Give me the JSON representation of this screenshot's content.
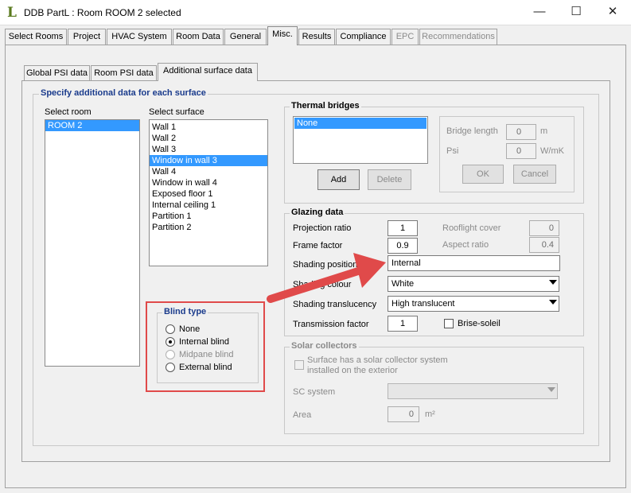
{
  "window": {
    "title": "DDB PartL : Room ROOM 2 selected",
    "logo_letter": "L",
    "minimize": "—",
    "maximize": "☐",
    "close": "✕"
  },
  "main_tabs": [
    "Select Rooms",
    "Project",
    "HVAC System",
    "Room Data",
    "General",
    "Misc.",
    "Results",
    "Compliance",
    "EPC",
    "Recommendations"
  ],
  "sub_tabs": [
    "Global PSI data",
    "Room PSI data",
    "Additional surface data"
  ],
  "section_title": "Specify additional data for each surface",
  "select_room": {
    "label": "Select room",
    "items": [
      "ROOM 2"
    ],
    "selected": 0
  },
  "select_surface": {
    "label": "Select surface",
    "items": [
      "Wall  1",
      "Wall  2",
      "Wall  3",
      "Window in wall  3",
      "Wall  4",
      "Window in wall  4",
      "Exposed floor  1",
      "Internal ceiling  1",
      "Partition  1",
      "Partition  2"
    ],
    "selected": 3
  },
  "blind_type": {
    "title": "Blind type",
    "options": [
      "None",
      "Internal blind",
      "Midpane blind",
      "External blind"
    ],
    "selected": 1,
    "disabled": [
      2
    ],
    "highlight_color": "#e04a4a"
  },
  "thermal_bridges": {
    "title": "Thermal bridges",
    "list": [
      "None"
    ],
    "add_label": "Add",
    "delete_label": "Delete",
    "bridge_length_label": "Bridge length",
    "bridge_length_value": "0",
    "bridge_length_unit": "m",
    "psi_label": "Psi",
    "psi_value": "0",
    "psi_unit": "W/mK",
    "ok_label": "OK",
    "cancel_label": "Cancel"
  },
  "glazing": {
    "title": "Glazing data",
    "projection_ratio_label": "Projection ratio",
    "projection_ratio": "1",
    "rooflight_cover_label": "Rooflight cover",
    "rooflight_cover": "0",
    "frame_factor_label": "Frame factor",
    "frame_factor": "0.9",
    "aspect_ratio_label": "Aspect ratio",
    "aspect_ratio": "0.4",
    "shading_position_label": "Shading position",
    "shading_position": "Internal",
    "shading_colour_label": "Shading colour",
    "shading_colour": "White",
    "shading_translucency_label": "Shading translucency",
    "shading_translucency": "High translucent",
    "transmission_factor_label": "Transmission factor",
    "transmission_factor": "1",
    "brise_soleil_label": "Brise-soleil"
  },
  "solar": {
    "title": "Solar collectors",
    "checkbox_label": "Surface has a solar collector system installed on the exterior",
    "sc_system_label": "SC system",
    "area_label": "Area",
    "area_value": "0",
    "area_unit": "m²"
  },
  "annotation": {
    "arrow_color": "#e04a4a"
  }
}
